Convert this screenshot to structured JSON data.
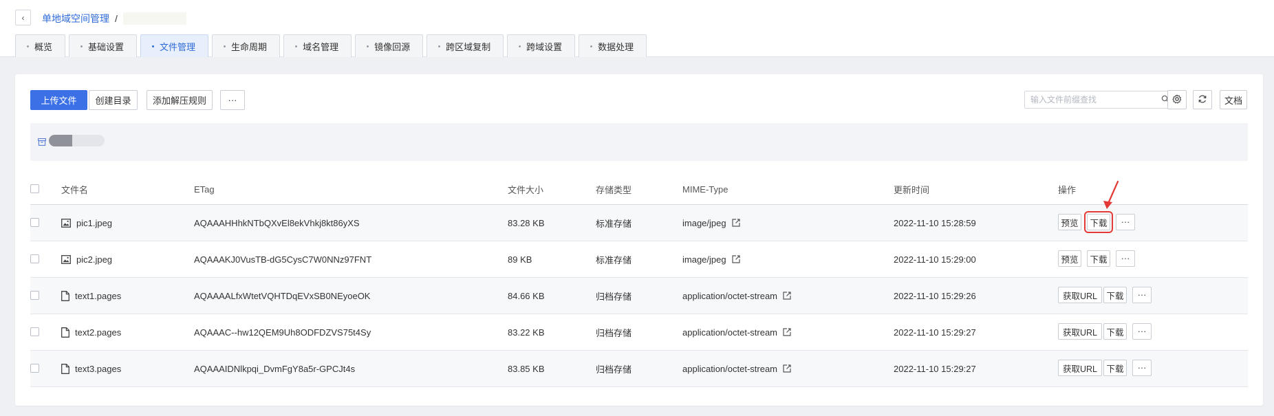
{
  "header": {
    "back_label": "‹",
    "breadcrumb_parent": "单地域空间管理",
    "breadcrumb_sep": "/"
  },
  "tabs": [
    {
      "label": "概览",
      "active": false
    },
    {
      "label": "基础设置",
      "active": false
    },
    {
      "label": "文件管理",
      "active": true
    },
    {
      "label": "生命周期",
      "active": false
    },
    {
      "label": "域名管理",
      "active": false
    },
    {
      "label": "镜像回源",
      "active": false
    },
    {
      "label": "跨区域复制",
      "active": false
    },
    {
      "label": "跨域设置",
      "active": false
    },
    {
      "label": "数据处理",
      "active": false
    }
  ],
  "toolbar": {
    "upload_label": "上传文件",
    "create_dir_label": "创建目录",
    "add_unzip_rule_label": "添加解压规则",
    "more_label": "···",
    "search_placeholder": "输入文件前缀查找",
    "docs_label": "文档"
  },
  "table": {
    "columns": [
      "文件名",
      "ETag",
      "文件大小",
      "存储类型",
      "MIME-Type",
      "更新时间",
      "操作"
    ],
    "rows": [
      {
        "name": "pic1.jpeg",
        "type_icon": "image-icon",
        "etag": "AQAAAHHhkNTbQXvEl8ekVhkj8kt86yXS",
        "size": "83.28 KB",
        "storage": "标准存储",
        "mime": "image/jpeg",
        "updated": "2022-11-10 15:28:59",
        "actions": [
          "预览",
          "下载",
          "···"
        ]
      },
      {
        "name": "pic2.jpeg",
        "type_icon": "image-icon",
        "etag": "AQAAAKJ0VusTB-dG5CysC7W0NNz97FNT",
        "size": "89 KB",
        "storage": "标准存储",
        "mime": "image/jpeg",
        "updated": "2022-11-10 15:29:00",
        "actions": [
          "预览",
          "下载",
          "···"
        ]
      },
      {
        "name": "text1.pages",
        "type_icon": "document-icon",
        "etag": "AQAAAALfxWtetVQHTDqEVxSB0NEyoeOK",
        "size": "84.66 KB",
        "storage": "归档存储",
        "mime": "application/octet-stream",
        "updated": "2022-11-10 15:29:26",
        "actions": [
          "获取URL",
          "下载",
          "···"
        ]
      },
      {
        "name": "text2.pages",
        "type_icon": "document-icon",
        "etag": "AQAAAC--hw12QEM9Uh8ODFDZVS75t4Sy",
        "size": "83.22 KB",
        "storage": "归档存储",
        "mime": "application/octet-stream",
        "updated": "2022-11-10 15:29:27",
        "actions": [
          "获取URL",
          "下载",
          "···"
        ]
      },
      {
        "name": "text3.pages",
        "type_icon": "document-icon",
        "etag": "AQAAAIDNlkpqi_DvmFgY8a5r-GPCJt4s",
        "size": "83.85 KB",
        "storage": "归档存储",
        "mime": "application/octet-stream",
        "updated": "2022-11-10 15:29:27",
        "actions": [
          "获取URL",
          "下载",
          "···"
        ]
      }
    ]
  },
  "annotation": {
    "highlight_color": "#e53935"
  },
  "colors": {
    "accent": "#3b70e6",
    "link": "#2f6bd8"
  }
}
